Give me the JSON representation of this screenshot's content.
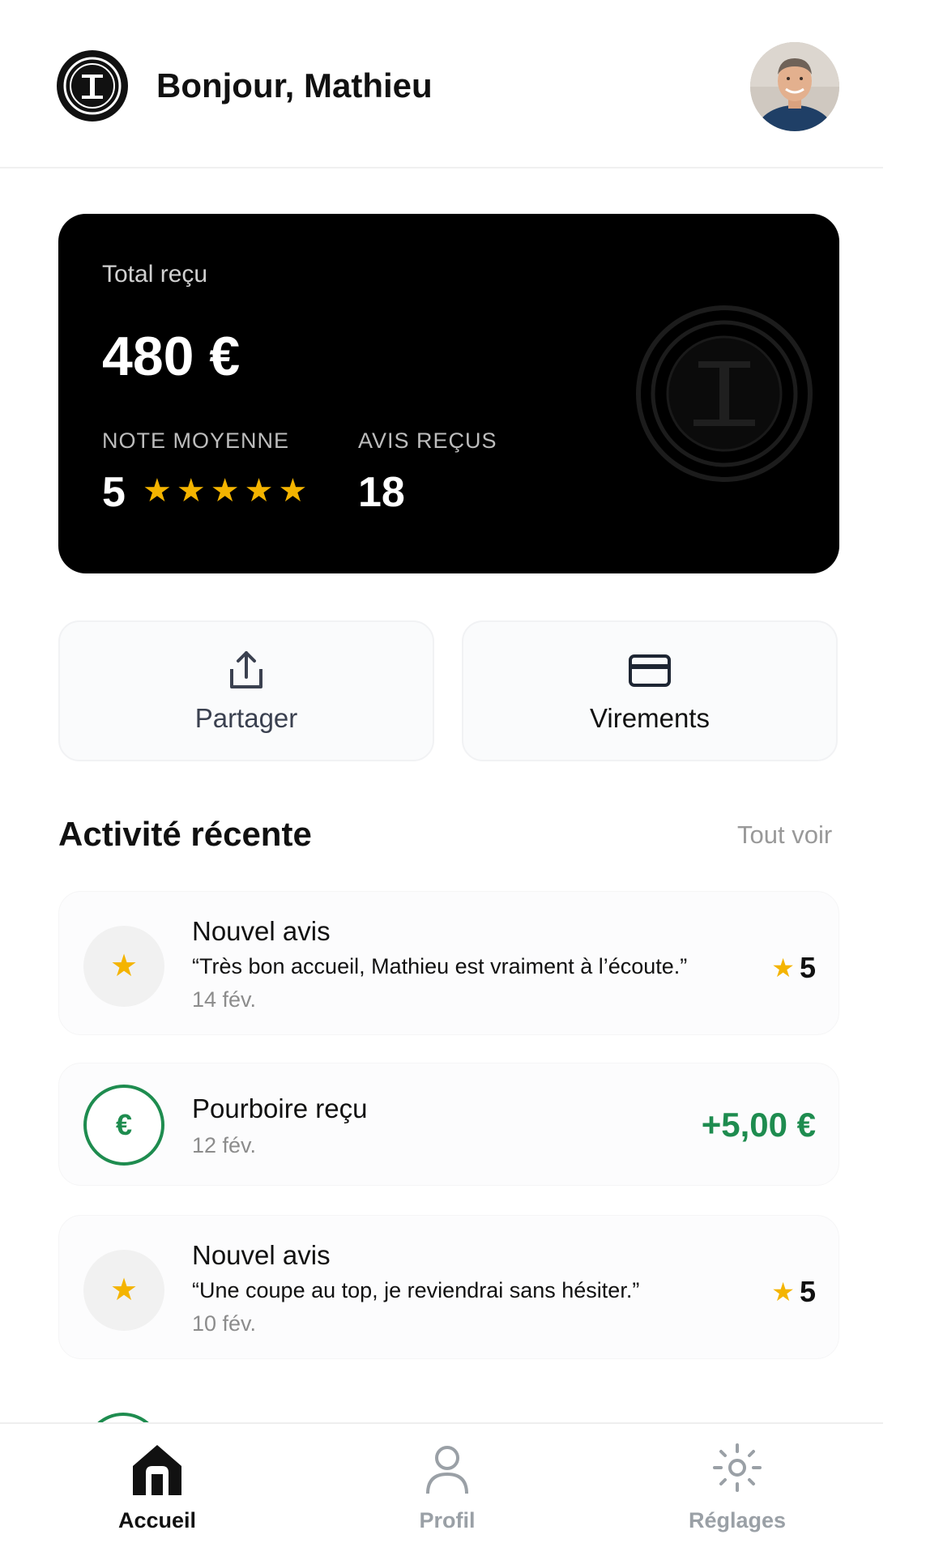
{
  "header": {
    "greeting": "Bonjour, Mathieu",
    "logo_icon": "brand-coin-logo",
    "avatar_icon": "user-avatar-photo"
  },
  "summary": {
    "total_label": "Total reçu",
    "total_value": "480 €",
    "rating_label": "NOTE MOYENNE",
    "rating_value": "5",
    "rating_stars": 5,
    "reviews_label": "AVIS REÇUS",
    "reviews_value": "18"
  },
  "actions": {
    "share_label": "Partager",
    "share_icon": "share-upload-icon",
    "transfers_label": "Virements",
    "transfers_icon": "card-icon"
  },
  "activity": {
    "title": "Activité récente",
    "see_all": "Tout voir",
    "items": [
      {
        "type": "review",
        "title": "Nouvel avis",
        "quote": "“Très bon accueil, Mathieu est vraiment à l’écoute.”",
        "date": "14 fév.",
        "rating": "5"
      },
      {
        "type": "tip",
        "title": "Pourboire reçu",
        "date": "12 fév.",
        "amount": "+5,00 €"
      },
      {
        "type": "review",
        "title": "Nouvel avis",
        "quote": "“Une coupe au top, je reviendrai sans hésiter.”",
        "date": "10 fév.",
        "rating": "5"
      }
    ]
  },
  "nav": {
    "home_label": "Accueil",
    "profile_label": "Profil",
    "settings_label": "Réglages",
    "active": "home"
  },
  "colors": {
    "card_background": "#000000",
    "star": "#f4b400",
    "money_green": "#1e8c4f",
    "muted": "#9aa0a6"
  }
}
